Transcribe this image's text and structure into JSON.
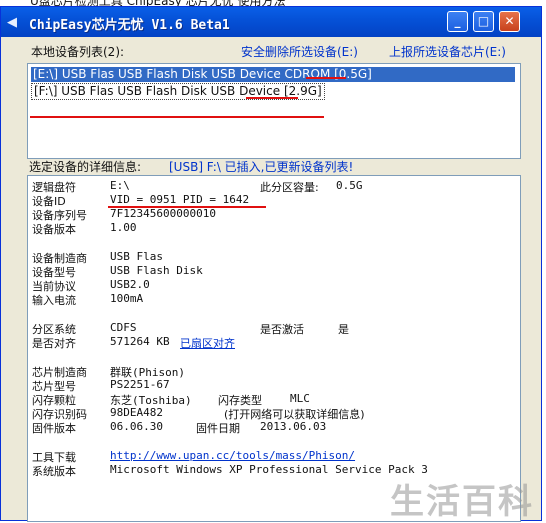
{
  "window": {
    "title": "ChipEasy芯片无忧 V1.6 Beta1",
    "min_glyph": "_",
    "max_glyph": "□",
    "close_glyph": "✕"
  },
  "devices": {
    "label": "本地设备列表(2):",
    "safe_remove_link": "安全删除所选设备(E:)",
    "report_link": "上报所选设备芯片(E:)",
    "items": [
      "[E:\\] USB Flas USB Flash Disk USB Device  CDROM [0.5G]",
      "[F:\\] USB Flas USB Flash Disk USB Device [2.9G]"
    ]
  },
  "details": {
    "label": "选定设备的详细信息:",
    "status": "[USB] F:\\ 已插入,已更新设备列表!",
    "drive_label": "逻辑盘符",
    "drive_value": "E:\\",
    "partition_cap_label": "此分区容量:",
    "partition_cap_value": "0.5G",
    "device_id_label": "设备ID",
    "vid_pid": "VID = 0951    PID = 1642",
    "serial_label": "设备序列号",
    "serial_value": "7F12345600000010",
    "version_label": "设备版本",
    "version_value": "1.00",
    "vendor_label": "设备制造商",
    "vendor_value": "USB Flas",
    "model_label": "设备型号",
    "model_value": "USB Flash Disk",
    "protocol_label": "当前协议",
    "protocol_value": "USB2.0",
    "current_label": "输入电流",
    "current_value": "100mA",
    "fs_label": "分区系统",
    "fs_value": "CDFS",
    "active_label": "是否激活",
    "active_value": "是",
    "align_label": "是否对齐",
    "align_value": "571264 KB",
    "align_link": "已扇区对齐",
    "chip_vendor_label": "芯片制造商",
    "chip_vendor_value": "群联(Phison)",
    "chip_model_label": "芯片型号",
    "chip_model_value": "PS2251-67",
    "flash_label": "闪存颗粒",
    "flash_value": "东芝(Toshiba)",
    "flash_type_label": "闪存类型",
    "flash_type_value": "MLC",
    "flash_id_label": "闪存识别码",
    "flash_id_value": "98DEA482",
    "flash_id_note": "(打开网络可以获取详细信息)",
    "fw_label": "固件版本",
    "fw_value": "06.06.30",
    "fw_date_label": "固件日期",
    "fw_date_value": "2013.06.03",
    "tools_label": "工具下载",
    "tools_link": "http://www.upan.cc/tools/mass/Phison/",
    "os_label": "系统版本",
    "os_value": "Microsoft Windows XP Professional Service Pack 3"
  },
  "watermark": "生活百科",
  "topbar_text": "U盘芯片检测工具 ChipEasy 芯片无忧 使用方法"
}
